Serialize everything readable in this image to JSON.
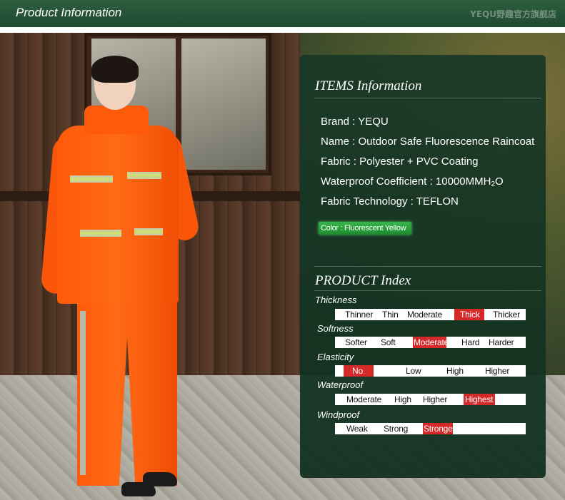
{
  "header": {
    "title": "Product Information",
    "watermark": "YEQU野趣官方旗舰店"
  },
  "panel": {
    "items_title": "ITEMS Information",
    "brand": "Brand :  YEQU",
    "name": "Name : Outdoor Safe Fluorescence Raincoat",
    "fabric": "Fabric : Polyester + PVC Coating",
    "waterproof_coefficient_prefix": "Waterproof Coefficient : 10000MMH",
    "waterproof_coefficient_sub": "2",
    "waterproof_coefficient_suffix": "O",
    "fabric_technology": "Fabric Technology : TEFLON",
    "color": "Color : Fluorescent Yellow",
    "index_title": "PRODUCT  Index"
  },
  "colors": {
    "header_green": "#1f4a30",
    "panel_green": "#183826",
    "highlight_red": "#d62a2a",
    "badge_green": "#2aa23c",
    "raincoat_orange": "#ff5a0a"
  },
  "index": [
    {
      "label": "Thickness",
      "levels": [
        "Thinner",
        "Thin",
        "Moderate",
        "Thick",
        "Thicker"
      ],
      "selected": "Thick"
    },
    {
      "label": "Softness",
      "levels": [
        "Softer",
        "Soft",
        "Moderate",
        "Hard",
        "Harder"
      ],
      "selected": "Moderate"
    },
    {
      "label": "Elasticity",
      "levels": [
        "No",
        "Low",
        "High",
        "Higher"
      ],
      "selected": "No"
    },
    {
      "label": "Waterproof",
      "levels": [
        "Moderate",
        "High",
        "Higher",
        "Highest"
      ],
      "selected": "Highest"
    },
    {
      "label": "Windproof",
      "levels": [
        "Weak",
        "Strong",
        "Stronger"
      ],
      "selected": "Stronger"
    }
  ]
}
